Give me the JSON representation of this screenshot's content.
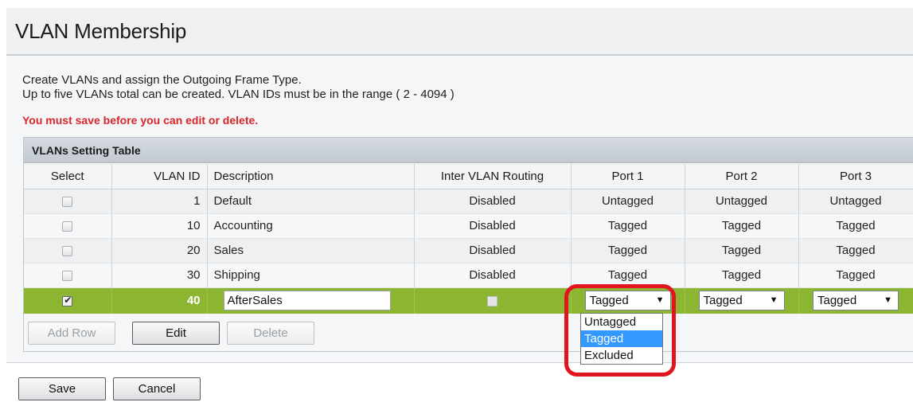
{
  "page": {
    "title": "VLAN Membership",
    "intro_line_1": "Create VLANs and assign the Outgoing Frame Type.",
    "intro_line_2": "Up to five VLANs total can be created. VLAN IDs must be in the range ( 2 - 4094 )",
    "warning": "You must save before you can edit or delete."
  },
  "table": {
    "caption": "VLANs Setting Table",
    "headers": [
      "Select",
      "VLAN ID",
      "Description",
      "Inter VLAN Routing",
      "Port 1",
      "Port 2",
      "Port 3"
    ],
    "rows": [
      {
        "vlan_id": "1",
        "description": "Default",
        "routing": "Disabled",
        "port1": "Untagged",
        "port2": "Untagged",
        "port3": "Untagged"
      },
      {
        "vlan_id": "10",
        "description": "Accounting",
        "routing": "Disabled",
        "port1": "Tagged",
        "port2": "Tagged",
        "port3": "Tagged"
      },
      {
        "vlan_id": "20",
        "description": "Sales",
        "routing": "Disabled",
        "port1": "Tagged",
        "port2": "Tagged",
        "port3": "Tagged"
      },
      {
        "vlan_id": "30",
        "description": "Shipping",
        "routing": "Disabled",
        "port1": "Tagged",
        "port2": "Tagged",
        "port3": "Tagged"
      }
    ],
    "edit_row": {
      "vlan_id": "40",
      "description_value": "AfterSales",
      "port1": "Tagged",
      "port2": "Tagged",
      "port3": "Tagged"
    }
  },
  "dropdown": {
    "options": [
      "Untagged",
      "Tagged",
      "Excluded"
    ],
    "selected": "Tagged"
  },
  "table_buttons": {
    "add_row": "Add Row",
    "edit": "Edit",
    "delete": "Delete"
  },
  "footer_buttons": {
    "save": "Save",
    "cancel": "Cancel"
  },
  "colors": {
    "edit_row_bg": "#8cb531",
    "warning_text": "#d8262b",
    "highlight_ring": "#e0151d",
    "selected_option": "#3399ff"
  },
  "icons": {
    "dropdown_arrow": "triangle-down"
  }
}
